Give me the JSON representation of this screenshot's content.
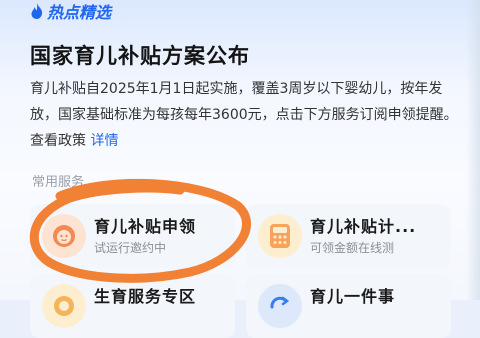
{
  "badge": {
    "label": "热点精选",
    "icon": "flame-icon",
    "color": "#1f66f0"
  },
  "headline": "国家育儿补贴方案公布",
  "body": {
    "text": "育儿补贴自2025年1月1日起实施，覆盖3周岁以下婴幼儿，按年发放，国家基础标准为每孩每年3600元，点击下方服务订阅申领提醒。查看政策",
    "link_label": "详情"
  },
  "section": {
    "label": "常用服务"
  },
  "services": [
    {
      "title": "育儿补贴申领",
      "subtitle": "试运行邀约中",
      "icon": "baby-face-icon"
    },
    {
      "title": "育儿补贴计...",
      "subtitle": "可领金额在线测",
      "icon": "calculator-icon"
    },
    {
      "title": "生育服务专区",
      "subtitle": "",
      "icon": "service-zone-icon"
    },
    {
      "title": "育儿一件事",
      "subtitle": "",
      "icon": "cycle-arrow-icon"
    }
  ],
  "colors": {
    "accent": "#1f66f0",
    "highlight_circle": "#f07a2a",
    "card_bg": "#f3f6fb",
    "icon_orange_bg": "#fde3d2",
    "icon_yellow_bg": "#fdeed0",
    "icon_blue_bg": "#dde8fb"
  }
}
